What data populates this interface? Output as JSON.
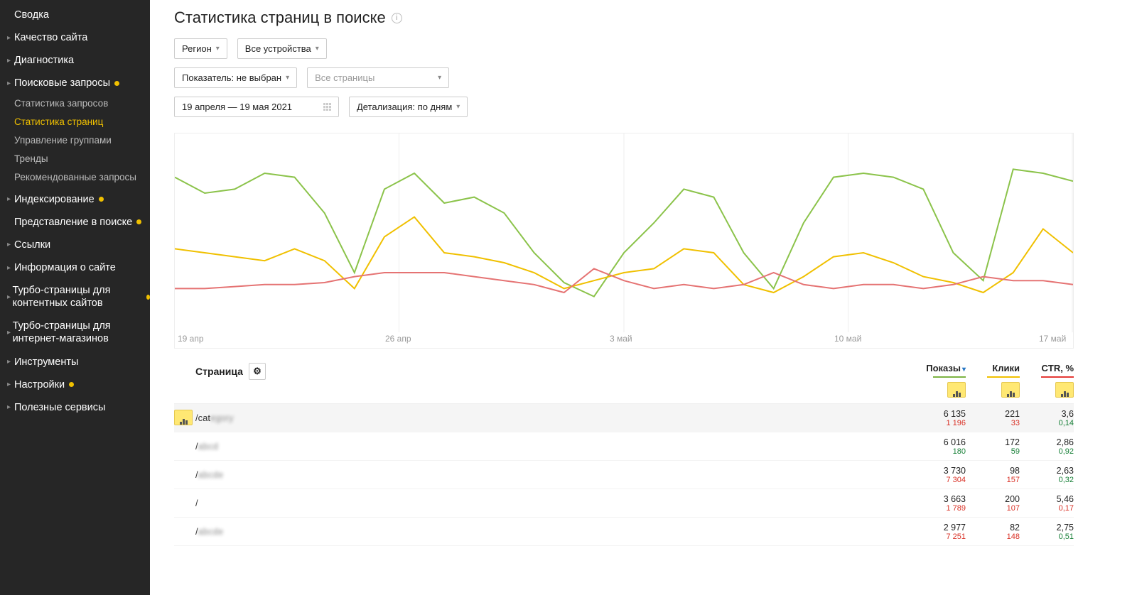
{
  "sidebar": {
    "items": [
      {
        "label": "Сводка",
        "caret": false,
        "dot": false,
        "sub": []
      },
      {
        "label": "Качество сайта",
        "caret": true,
        "dot": false,
        "sub": []
      },
      {
        "label": "Диагностика",
        "caret": true,
        "dot": false,
        "sub": []
      },
      {
        "label": "Поисковые запросы",
        "caret": true,
        "dot": true,
        "sub": [
          {
            "label": "Статистика запросов",
            "active": false,
            "dot": false
          },
          {
            "label": "Статистика страниц",
            "active": true,
            "dot": false
          },
          {
            "label": "Управление группами",
            "active": false,
            "dot": false
          },
          {
            "label": "Тренды",
            "active": false,
            "dot": true
          },
          {
            "label": "Рекомендованные запросы",
            "active": false,
            "dot": false
          }
        ]
      },
      {
        "label": "Индексирование",
        "caret": true,
        "dot": true,
        "sub": []
      },
      {
        "label": "Представление в поиске",
        "caret": false,
        "dot": true,
        "sub": []
      },
      {
        "label": "Ссылки",
        "caret": true,
        "dot": false,
        "sub": []
      },
      {
        "label": "Информация о сайте",
        "caret": true,
        "dot": false,
        "sub": []
      },
      {
        "label": "Турбо-страницы для контентных сайтов",
        "caret": true,
        "dot": true,
        "sub": []
      },
      {
        "label": "Турбо-страницы для интернет-магазинов",
        "caret": true,
        "dot": false,
        "sub": []
      },
      {
        "label": "Инструменты",
        "caret": true,
        "dot": false,
        "sub": []
      },
      {
        "label": "Настройки",
        "caret": true,
        "dot": true,
        "sub": []
      },
      {
        "label": "Полезные сервисы",
        "caret": true,
        "dot": false,
        "sub": []
      }
    ]
  },
  "page_title": "Статистика страниц в поиске",
  "filters": {
    "region": "Регион",
    "devices": "Все устройства",
    "metric": "Показатель: не выбран",
    "pages_placeholder": "Все страницы",
    "date_range": "19 апреля — 19 мая 2021",
    "detail": "Детализация: по дням"
  },
  "chart_data": {
    "type": "line",
    "x_ticks": [
      "19 апр",
      "26 апр",
      "3 май",
      "10 май",
      "17 май"
    ],
    "categories": [
      "19",
      "20",
      "21",
      "22",
      "23",
      "24",
      "25",
      "26",
      "27",
      "28",
      "29",
      "30",
      "1",
      "2",
      "3",
      "4",
      "5",
      "6",
      "7",
      "8",
      "9",
      "10",
      "11",
      "12",
      "13",
      "14",
      "15",
      "16",
      "17",
      "18",
      "19"
    ],
    "series": [
      {
        "name": "Показы",
        "color": "#8bc34a",
        "values": [
          78,
          70,
          72,
          80,
          78,
          60,
          30,
          72,
          80,
          65,
          68,
          60,
          40,
          25,
          18,
          40,
          55,
          72,
          68,
          40,
          22,
          55,
          78,
          80,
          78,
          72,
          40,
          26,
          82,
          80,
          76
        ]
      },
      {
        "name": "Клики",
        "color": "#f0c000",
        "values": [
          42,
          40,
          38,
          36,
          42,
          36,
          22,
          48,
          58,
          40,
          38,
          35,
          30,
          22,
          26,
          30,
          32,
          42,
          40,
          24,
          20,
          28,
          38,
          40,
          35,
          28,
          25,
          20,
          30,
          52,
          40
        ]
      },
      {
        "name": "CTR, %",
        "color": "#e57373",
        "values": [
          22,
          22,
          23,
          24,
          24,
          25,
          28,
          30,
          30,
          30,
          28,
          26,
          24,
          20,
          32,
          26,
          22,
          24,
          22,
          24,
          30,
          24,
          22,
          24,
          24,
          22,
          24,
          28,
          26,
          26,
          24
        ]
      }
    ],
    "y_range": [
      0,
      100
    ]
  },
  "table": {
    "page_header": "Страница",
    "metrics": [
      {
        "label": "Показы",
        "sorted": true,
        "color": "green"
      },
      {
        "label": "Клики",
        "sorted": false,
        "color": "yellow"
      },
      {
        "label": "CTR, %",
        "sorted": false,
        "color": "red"
      }
    ],
    "rows": [
      {
        "selected": true,
        "page_prefix": "/cat",
        "page_blur": "egory",
        "m": [
          [
            "6 135",
            "1 196",
            "red"
          ],
          [
            "221",
            "33",
            "red"
          ],
          [
            "3,6",
            "0,14",
            "green"
          ]
        ]
      },
      {
        "selected": false,
        "page_prefix": "/",
        "page_blur": "abcd",
        "m": [
          [
            "6 016",
            "180",
            "green"
          ],
          [
            "172",
            "59",
            "green"
          ],
          [
            "2,86",
            "0,92",
            "green"
          ]
        ]
      },
      {
        "selected": false,
        "page_prefix": "/",
        "page_blur": "abcde",
        "m": [
          [
            "3 730",
            "7 304",
            "red"
          ],
          [
            "98",
            "157",
            "red"
          ],
          [
            "2,63",
            "0,32",
            "green"
          ]
        ]
      },
      {
        "selected": false,
        "page_prefix": "/",
        "page_blur": "",
        "m": [
          [
            "3 663",
            "1 789",
            "red"
          ],
          [
            "200",
            "107",
            "red"
          ],
          [
            "5,46",
            "0,17",
            "red"
          ]
        ]
      },
      {
        "selected": false,
        "page_prefix": "/",
        "page_blur": "abcde",
        "m": [
          [
            "2 977",
            "7 251",
            "red"
          ],
          [
            "82",
            "148",
            "red"
          ],
          [
            "2,75",
            "0,51",
            "green"
          ]
        ]
      }
    ]
  }
}
